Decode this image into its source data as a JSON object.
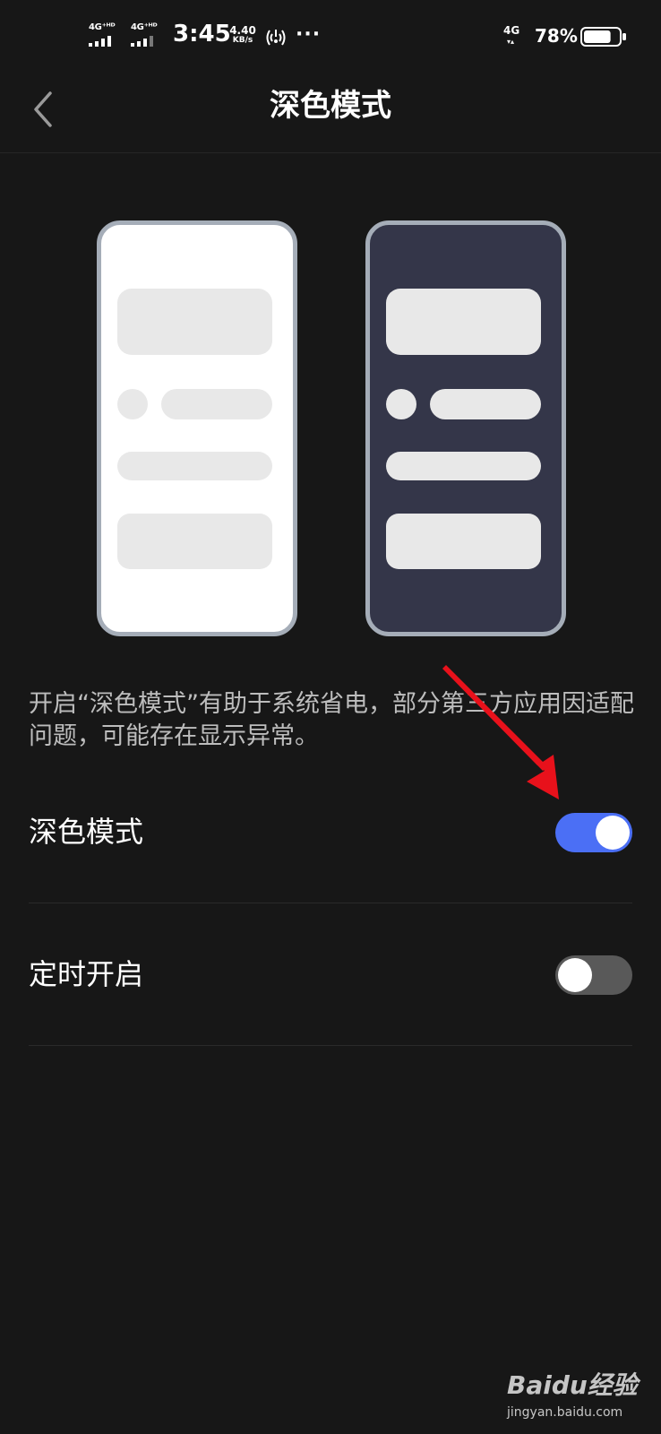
{
  "status_bar": {
    "sim1_network": "4G⁺ᴴᴰ",
    "sim2_network": "4G⁺ᴴᴰ",
    "time": "3:45",
    "net_speed_value": "4.40",
    "net_speed_unit": "KB/s",
    "more_indicator": "···",
    "cellular_type": "4G",
    "cellular_arrows": "▾▴",
    "battery_percent": "78%",
    "battery_level": 0.78,
    "icons": [
      "signal-icon",
      "signal-icon",
      "hotspot-icon",
      "battery-icon"
    ]
  },
  "header": {
    "title": "深色模式",
    "back_icon": "chevron-left-icon"
  },
  "previews": [
    {
      "theme": "light",
      "background": "#ffffff"
    },
    {
      "theme": "dark",
      "background": "#343649"
    }
  ],
  "description": "开启“深色模式”有助于系统省电，部分第三方应用因适配问题，可能存在显示异常。",
  "settings": [
    {
      "label": "深色模式",
      "enabled": true
    },
    {
      "label": "定时开启",
      "enabled": false
    }
  ],
  "colors": {
    "background": "#171717",
    "toggle_on": "#4b6ff5",
    "toggle_off": "#595959",
    "annotation_arrow": "#e8111b"
  },
  "watermark": {
    "logo": "Baidu经验",
    "url": "jingyan.baidu.com"
  }
}
